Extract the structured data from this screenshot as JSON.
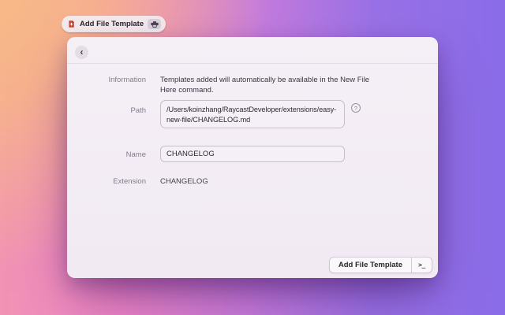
{
  "pill": {
    "title": "Add File Template"
  },
  "window": {
    "back_glyph": "‹",
    "form": {
      "rows": [
        {
          "label": "Information",
          "value": "Templates added will automatically be available in the New File Here command."
        },
        {
          "label": "Path",
          "value": "/Users/koinzhang/RaycastDeveloper/extensions/easy-new-file/CHANGELOG.md",
          "help_glyph": "?"
        },
        {
          "label": "Name",
          "value": "CHANGELOG"
        },
        {
          "label": "Extension",
          "value": "CHANGELOG"
        }
      ]
    },
    "footer": {
      "primary_label": "Add File Template",
      "shortcut_glyph": ">_"
    }
  },
  "icons": {
    "pill_left": "new-file-icon",
    "pill_right": "printer-icon",
    "path_help": "question-mark-icon",
    "footer_right": "terminal-prompt-icon"
  },
  "colors": {
    "gradient_orange": "#f8be83",
    "gradient_pink": "#ee85c6",
    "gradient_purple": "#8a6ce8",
    "window_bg": "#f3edf5",
    "field_border": "#c8bdca",
    "label_text": "#857c8c",
    "body_text": "#36313b"
  }
}
